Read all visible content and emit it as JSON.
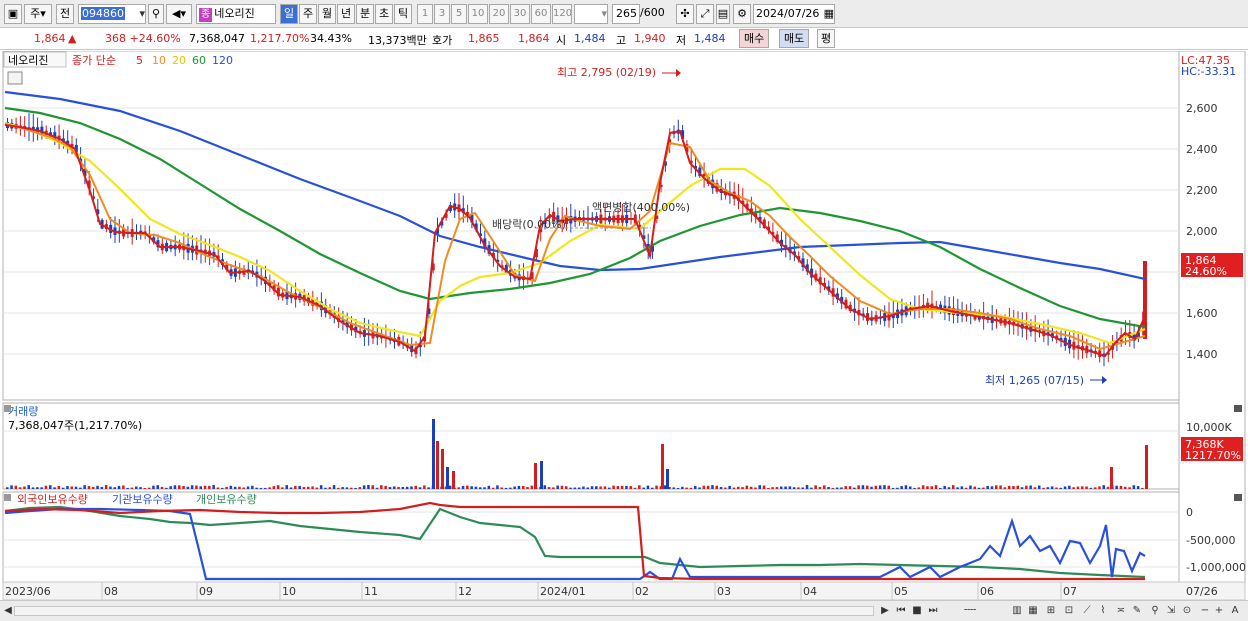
{
  "toolbar": {
    "mode": "주",
    "prev": "전",
    "code": "094860",
    "stock_name": "네오리진",
    "stock_tag": "종",
    "periods": [
      "일",
      "주",
      "월",
      "년",
      "분",
      "초",
      "틱"
    ],
    "active_period": "일",
    "intervals": [
      "1",
      "3",
      "5",
      "10",
      "20",
      "30",
      "60",
      "120"
    ],
    "count": "265",
    "count_max": "/600",
    "date": "2024/07/26"
  },
  "quote": {
    "price": "1,864",
    "arrow": "▲",
    "change": "368 +24.60%",
    "volume": "7,368,047",
    "volume_rate": "1,217.70%",
    "turnover": "34.43%",
    "amount": "13,373백만",
    "bid_label": "호가",
    "bid1": "1,865",
    "bid2": "1,864",
    "open_label": "시",
    "open": "1,484",
    "high_label": "고",
    "high": "1,940",
    "low_label": "저",
    "low": "1,484",
    "buy_btn": "매수",
    "sell_btn": "매도",
    "avg_btn": "평"
  },
  "price_panel": {
    "name": "네오리진",
    "legend_prefix": "종가 단순",
    "ma_periods": [
      "5",
      "10",
      "20",
      "60",
      "120"
    ],
    "ma_colors": [
      "#d21e1e",
      "#f08c1e",
      "#f0e61e",
      "#1e9632",
      "#2850dc"
    ],
    "lc": "LC:47.35",
    "hc": "HC:-33.31",
    "annot_high": "최고 2,795 (02/19)",
    "annot_low": "최저 1,265 (07/15)",
    "annot_div": "배당락(0.00%)",
    "annot_split": "액면병합(400.00%)",
    "last_price": "1,864",
    "last_pct": "24.60%",
    "yticks": [
      "2,600",
      "2,400",
      "2,200",
      "2,000",
      "1,800",
      "1,600",
      "1,400"
    ]
  },
  "volume_panel": {
    "title": "거래량",
    "value": "7,368,047주(1,217.70%)",
    "ytick": "10,000K",
    "last_vol": "7,368K",
    "last_pct": "1217.70%"
  },
  "holding_panel": {
    "labels": [
      "외국인보유수량",
      "기관보유수량",
      "개인보유수량"
    ],
    "colors": [
      "#d21e1e",
      "#2850dc",
      "#2e8b57"
    ],
    "yticks": [
      "0",
      "-500,000",
      "-1,000,000"
    ]
  },
  "xaxis": {
    "labels": [
      "2023/06",
      "08",
      "09",
      "10",
      "11",
      "12",
      "2024/01",
      "02",
      "03",
      "04",
      "05",
      "06",
      "07"
    ],
    "right_label": "07/26"
  },
  "chart_data": {
    "type": "candlestick",
    "xrange": [
      "2023/06",
      "2024/07/26"
    ],
    "ylim": [
      1265,
      2795
    ],
    "high": {
      "value": 2795,
      "date": "02/19"
    },
    "low": {
      "value": 1265,
      "date": "07/15"
    },
    "last": {
      "open": 1484,
      "high": 1940,
      "low": 1484,
      "close": 1864,
      "change_pct": 24.6
    }
  }
}
